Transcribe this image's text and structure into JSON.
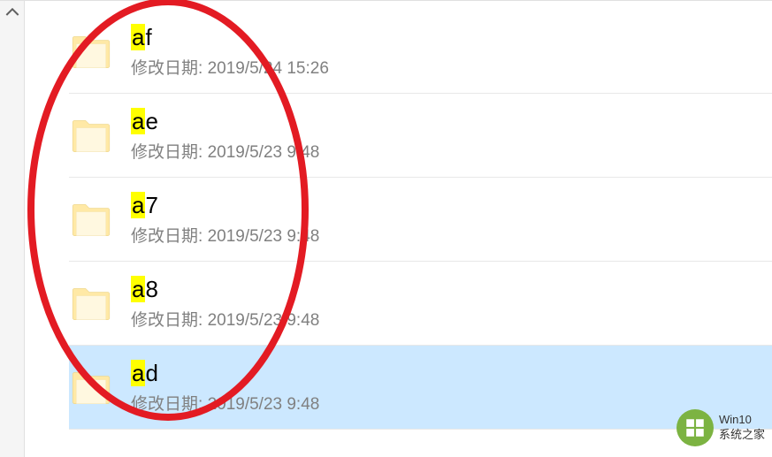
{
  "scrollbar": {
    "direction": "up"
  },
  "files": [
    {
      "name_highlight": "a",
      "name_rest": "f",
      "date_label": "修改日期:",
      "date_value": "2019/5/24 15:26",
      "selected": false
    },
    {
      "name_highlight": "a",
      "name_rest": "e",
      "date_label": "修改日期:",
      "date_value": "2019/5/23 9:48",
      "selected": false
    },
    {
      "name_highlight": "a",
      "name_rest": "7",
      "date_label": "修改日期:",
      "date_value": "2019/5/23 9:48",
      "selected": false
    },
    {
      "name_highlight": "a",
      "name_rest": "8",
      "date_label": "修改日期:",
      "date_value": "2019/5/23 9:48",
      "selected": false
    },
    {
      "name_highlight": "a",
      "name_rest": "d",
      "date_label": "修改日期:",
      "date_value": "2019/5/23 9:48",
      "selected": true
    }
  ],
  "watermark": {
    "line1": "Win10",
    "line2": "系统之家"
  },
  "annotation": {
    "color": "#e31b23"
  }
}
